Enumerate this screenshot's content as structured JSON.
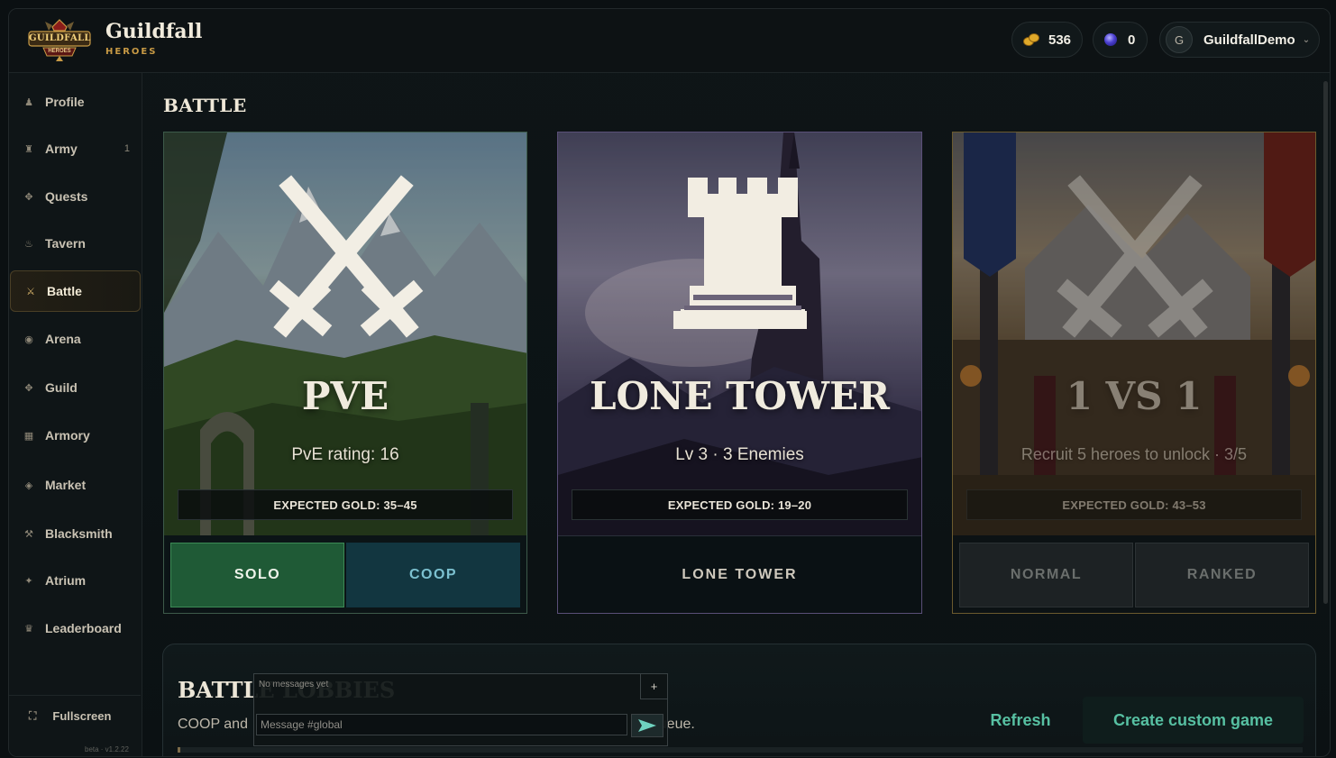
{
  "brand": {
    "title": "Guildfall",
    "subtitle": "HEROES",
    "logo_text": "GUILDFALL",
    "logo_subtext": "HEROES"
  },
  "header": {
    "gold": "536",
    "gems": "0",
    "avatar_initial": "G",
    "username": "GuildfallDemo",
    "gold_icon": "coins-icon",
    "gem_icon": "gem-icon"
  },
  "sidebar": {
    "items": [
      {
        "label": "Profile",
        "icon": "profile-icon",
        "glyph": "♟",
        "badge": ""
      },
      {
        "label": "Army",
        "icon": "army-icon",
        "glyph": "♜",
        "badge": "1"
      },
      {
        "label": "Quests",
        "icon": "quests-icon",
        "glyph": "✥",
        "badge": ""
      },
      {
        "label": "Tavern",
        "icon": "tavern-icon",
        "glyph": "♨",
        "badge": ""
      },
      {
        "label": "Battle",
        "icon": "swords-icon",
        "glyph": "⚔",
        "badge": ""
      },
      {
        "label": "Arena",
        "icon": "arena-icon",
        "glyph": "◉",
        "badge": ""
      },
      {
        "label": "Guild",
        "icon": "guild-icon",
        "glyph": "✥",
        "badge": ""
      },
      {
        "label": "Armory",
        "icon": "armory-icon",
        "glyph": "▦",
        "badge": ""
      },
      {
        "label": "Market",
        "icon": "market-icon",
        "glyph": "◈",
        "badge": ""
      },
      {
        "label": "Blacksmith",
        "icon": "hammer-icon",
        "glyph": "⚒",
        "badge": ""
      },
      {
        "label": "Atrium",
        "icon": "atrium-icon",
        "glyph": "✦",
        "badge": ""
      },
      {
        "label": "Leaderboard",
        "icon": "crown-icon",
        "glyph": "♛",
        "badge": ""
      }
    ],
    "active": "Battle",
    "fullscreen_label": "Fullscreen",
    "version": "beta · v1.2.22"
  },
  "main": {
    "section_title": "BATTLE",
    "cards": [
      {
        "name": "PVE",
        "subtitle": "PvE rating: 16",
        "expected_gold": "EXPECTED GOLD: 35–45",
        "buttons": [
          "SOLO",
          "COOP"
        ],
        "locked": false
      },
      {
        "name": "LONE TOWER",
        "subtitle": "Lv 3 · 3 Enemies",
        "expected_gold": "EXPECTED GOLD: 19–20",
        "buttons": [
          "LONE TOWER"
        ],
        "locked": false
      },
      {
        "name": "1 VS 1",
        "subtitle": "Recruit 5 heroes to unlock · 3/5",
        "expected_gold": "EXPECTED GOLD: 43–53",
        "buttons": [
          "NORMAL",
          "RANKED"
        ],
        "locked": true
      }
    ]
  },
  "lobbies": {
    "title": "BATTLE LOBBIES",
    "description_start": "COOP and",
    "description_end": "queue.",
    "refresh_label": "Refresh",
    "create_label": "Create custom game"
  },
  "chat": {
    "empty_text": "No messages yet",
    "plus_label": "+",
    "input_placeholder": "Message #global",
    "input_value": ""
  },
  "colors": {
    "accent_gold": "#c89a45",
    "accent_teal": "#57c0a2",
    "solo_green": "#1f5a36",
    "coop_teal": "#123640"
  }
}
